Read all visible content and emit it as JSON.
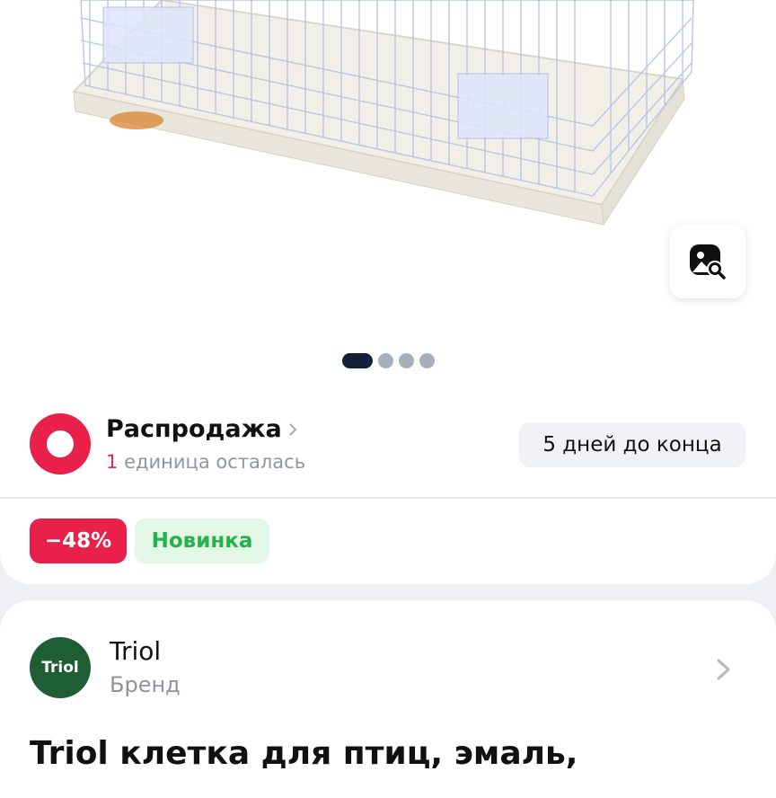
{
  "sale": {
    "title": "Распродажа",
    "count": "1",
    "subtitle": "единица осталась",
    "days_left": "5 дней до конца"
  },
  "badges": {
    "discount": "−48%",
    "new": "Новинка"
  },
  "gallery": {
    "total_images": 4,
    "active_index": 0
  },
  "brand": {
    "logo_text": "Triol",
    "name": "Triol",
    "label": "Бренд"
  },
  "product": {
    "title": "Triol клетка для птиц, эмаль,"
  },
  "colors": {
    "accent_red": "#e8204a",
    "new_green": "#27b14a",
    "brand_green": "#1f5e35"
  }
}
